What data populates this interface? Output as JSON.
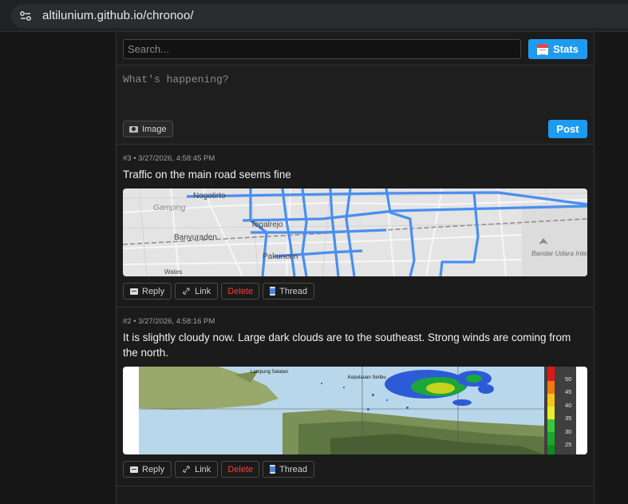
{
  "browser": {
    "url": "altilunium.github.io/chronoo/"
  },
  "toolbar": {
    "search_placeholder": "Search...",
    "stats_label": "Stats"
  },
  "composer": {
    "placeholder": "What's happening?",
    "image_label": "Image",
    "post_label": "Post"
  },
  "posts": [
    {
      "meta": "#3 • 3/27/2026, 4:58:45 PM",
      "text": "Traffic on the main road seems fine",
      "image": "map",
      "actions": {
        "reply": "Reply",
        "link": "Link",
        "delete": "Delete",
        "thread": "Thread"
      },
      "map_labels": [
        "Nogotirto",
        "Gamping",
        "Tegalrejo",
        "Banyuraden",
        "Pakuncen",
        "Bandar Udara Internasional",
        "Wates"
      ]
    },
    {
      "meta": "#2 • 3/27/2026, 4:58:16 PM",
      "text": "It is slightly cloudy now. Large dark clouds are to the southeast. Strong winds are coming from the north.",
      "image": "radar",
      "actions": {
        "reply": "Reply",
        "link": "Link",
        "delete": "Delete",
        "thread": "Thread"
      },
      "radar_labels": [
        "Kepulauan Seribu",
        "Lampung Selatan"
      ],
      "radar_legend": [
        "50",
        "45",
        "40",
        "35",
        "30",
        "25"
      ]
    }
  ],
  "colors": {
    "accent": "#1d9bf0",
    "delete": "#ff3b3b",
    "map_route": "#4a8ef0",
    "background": "#1b1b1b"
  }
}
